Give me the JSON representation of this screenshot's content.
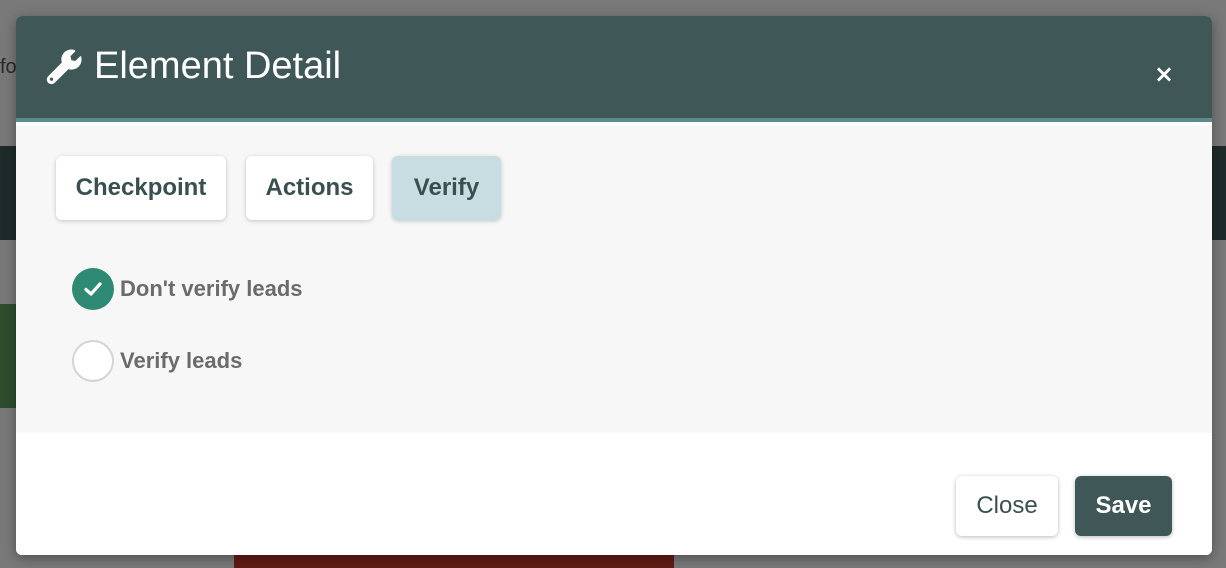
{
  "background": {
    "partial_text": "fo"
  },
  "modal": {
    "title": "Element Detail",
    "title_icon": "wrench-icon",
    "close_icon": "close-icon",
    "close_glyph": "×",
    "tabs": [
      {
        "label": "Checkpoint",
        "active": false
      },
      {
        "label": "Actions",
        "active": false
      },
      {
        "label": "Verify",
        "active": true
      }
    ],
    "radio_options": [
      {
        "label": "Don't verify leads",
        "checked": true
      },
      {
        "label": "Verify leads",
        "checked": false
      }
    ],
    "footer": {
      "close_label": "Close",
      "save_label": "Save"
    }
  },
  "colors": {
    "header_bg": "#3f5757",
    "header_border": "#5b8c8a",
    "active_tab_bg": "#c7dde2",
    "radio_checked": "#2e8a74",
    "save_button_bg": "#3f5757"
  }
}
